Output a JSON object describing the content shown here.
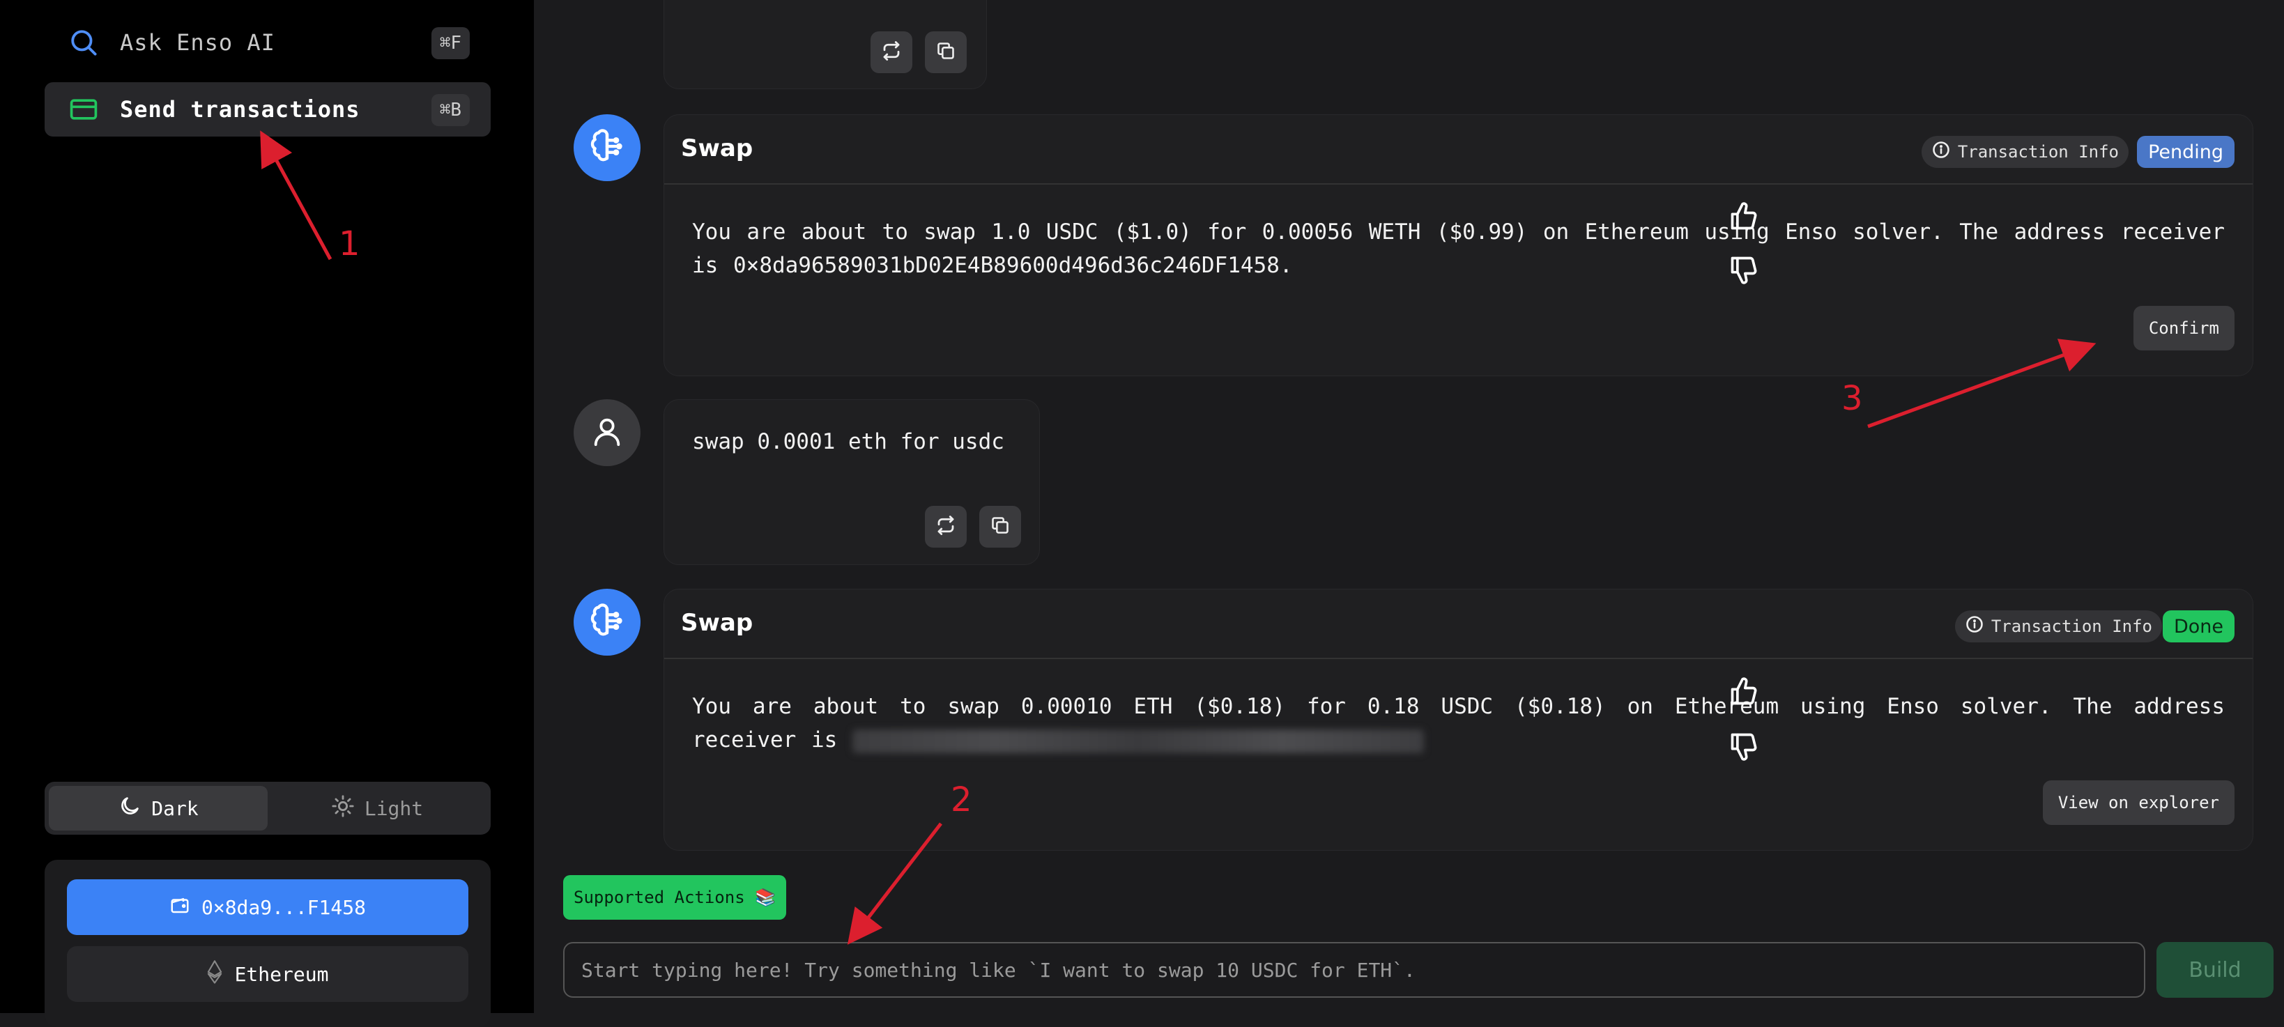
{
  "sidebar": {
    "search": {
      "label": "Ask Enso AI",
      "shortcut": "⌘F"
    },
    "send": {
      "label": "Send transactions",
      "shortcut": "⌘B"
    },
    "theme": {
      "dark": "Dark",
      "light": "Light",
      "selected": "Dark"
    },
    "wallet": {
      "address": "0×8da9...F1458",
      "chain": "Ethereum"
    }
  },
  "chat": {
    "top_user_message": {
      "text": ""
    },
    "swap1": {
      "title": "Swap",
      "info_label": "Transaction Info",
      "status": "Pending",
      "body": "You are about to swap 1.0 USDC ($1.0) for 0.00056 WETH ($0.99) on Ethereum using Enso solver. The address receiver is 0×8da96589031bD02E4B89600d496d36c246DF1458.",
      "button": "Confirm"
    },
    "user_message": {
      "text": "swap 0.0001 eth for usdc"
    },
    "swap2": {
      "title": "Swap",
      "info_label": "Transaction Info",
      "status": "Done",
      "body": "You are about to swap 0.00010 ETH ($0.18) for 0.18 USDC ($0.18) on Ethereum using Enso solver. The address receiver is",
      "button": "View on explorer"
    }
  },
  "composer": {
    "supported_actions": "Supported Actions 📚",
    "placeholder": "Start typing here! Try something like `I want to swap 10 USDC for ETH`.",
    "build": "Build"
  },
  "annotations": {
    "a1": "1",
    "a2": "2",
    "a3": "3"
  },
  "colors": {
    "accent_blue": "#3b82f6",
    "done_green": "#22c55e",
    "pending_blue": "#4a77c7",
    "annotation_red": "#dc1f2e"
  }
}
